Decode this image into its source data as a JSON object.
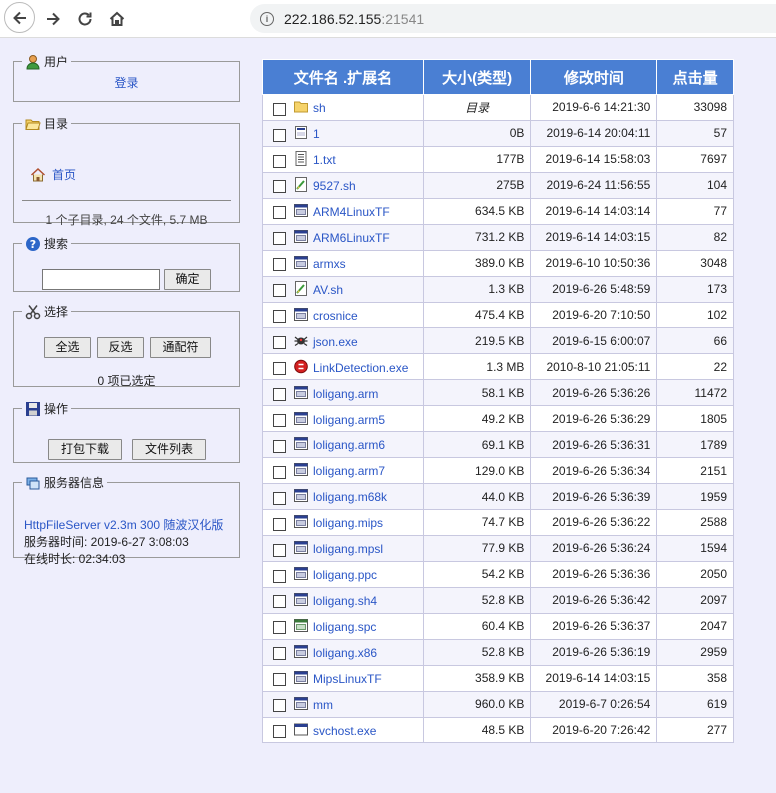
{
  "browser": {
    "url_host": "222.186.52.155",
    "url_port": ":21541"
  },
  "user_panel": {
    "legend": "用户",
    "login_link": "登录"
  },
  "dir_panel": {
    "legend": "目录",
    "home_link": "首页",
    "summary": "1 个子目录, 24 个文件, 5.7 MB"
  },
  "search_panel": {
    "legend": "搜索",
    "input_value": "",
    "submit_label": "确定"
  },
  "select_panel": {
    "legend": "选择",
    "select_all": "全选",
    "invert": "反选",
    "wildcard": "通配符",
    "selected_count": "0 项已选定"
  },
  "actions_panel": {
    "legend": "操作",
    "download_zip": "打包下载",
    "file_list": "文件列表"
  },
  "server_panel": {
    "legend": "服务器信息",
    "server_link": "HttpFileServer v2.3m 300 随波汉化版",
    "server_time": "服务器时间: 2019-6-27 3:08:03",
    "uptime": "在线时长: 02:34:03"
  },
  "table": {
    "headers": {
      "name": "文件名 .扩展名",
      "size": "大小(类型)",
      "modified": "修改时间",
      "hits": "点击量"
    },
    "rows": [
      {
        "icon": "folder-icon",
        "name": "sh",
        "size": "目录",
        "modified": "2019-6-6 14:21:30",
        "hits": "33098"
      },
      {
        "icon": "file-icon",
        "name": "1",
        "size": "0B",
        "modified": "2019-6-14 20:04:11",
        "hits": "57"
      },
      {
        "icon": "text-file-icon",
        "name": "1.txt",
        "size": "177B",
        "modified": "2019-6-14 15:58:03",
        "hits": "7697"
      },
      {
        "icon": "script-icon",
        "name": "9527.sh",
        "size": "275B",
        "modified": "2019-6-24 11:56:55",
        "hits": "104"
      },
      {
        "icon": "binary-icon",
        "name": "ARM4LinuxTF",
        "size": "634.5 KB",
        "modified": "2019-6-14 14:03:14",
        "hits": "77"
      },
      {
        "icon": "binary-icon",
        "name": "ARM6LinuxTF",
        "size": "731.2 KB",
        "modified": "2019-6-14 14:03:15",
        "hits": "82"
      },
      {
        "icon": "binary-icon",
        "name": "armxs",
        "size": "389.0 KB",
        "modified": "2019-6-10 10:50:36",
        "hits": "3048"
      },
      {
        "icon": "script-icon",
        "name": "AV.sh",
        "size": "1.3 KB",
        "modified": "2019-6-26 5:48:59",
        "hits": "173"
      },
      {
        "icon": "binary-icon",
        "name": "crosnice",
        "size": "475.4 KB",
        "modified": "2019-6-20 7:10:50",
        "hits": "102"
      },
      {
        "icon": "bug-icon",
        "name": "json.exe",
        "size": "219.5 KB",
        "modified": "2019-6-15 6:00:07",
        "hits": "66"
      },
      {
        "icon": "red-exe-icon",
        "name": "LinkDetection.exe",
        "size": "1.3 MB",
        "modified": "2010-8-10 21:05:11",
        "hits": "22"
      },
      {
        "icon": "binary-icon",
        "name": "loligang.arm",
        "size": "58.1 KB",
        "modified": "2019-6-26 5:36:26",
        "hits": "11472"
      },
      {
        "icon": "binary-icon",
        "name": "loligang.arm5",
        "size": "49.2 KB",
        "modified": "2019-6-26 5:36:29",
        "hits": "1805"
      },
      {
        "icon": "binary-icon",
        "name": "loligang.arm6",
        "size": "69.1 KB",
        "modified": "2019-6-26 5:36:31",
        "hits": "1789"
      },
      {
        "icon": "binary-icon",
        "name": "loligang.arm7",
        "size": "129.0 KB",
        "modified": "2019-6-26 5:36:34",
        "hits": "2151"
      },
      {
        "icon": "binary-icon",
        "name": "loligang.m68k",
        "size": "44.0 KB",
        "modified": "2019-6-26 5:36:39",
        "hits": "1959"
      },
      {
        "icon": "binary-icon",
        "name": "loligang.mips",
        "size": "74.7 KB",
        "modified": "2019-6-26 5:36:22",
        "hits": "2588"
      },
      {
        "icon": "binary-icon",
        "name": "loligang.mpsl",
        "size": "77.9 KB",
        "modified": "2019-6-26 5:36:24",
        "hits": "1594"
      },
      {
        "icon": "binary-icon",
        "name": "loligang.ppc",
        "size": "54.2 KB",
        "modified": "2019-6-26 5:36:36",
        "hits": "2050"
      },
      {
        "icon": "binary-icon",
        "name": "loligang.sh4",
        "size": "52.8 KB",
        "modified": "2019-6-26 5:36:42",
        "hits": "2097"
      },
      {
        "icon": "green-binary-icon",
        "name": "loligang.spc",
        "size": "60.4 KB",
        "modified": "2019-6-26 5:36:37",
        "hits": "2047"
      },
      {
        "icon": "binary-icon",
        "name": "loligang.x86",
        "size": "52.8 KB",
        "modified": "2019-6-26 5:36:19",
        "hits": "2959"
      },
      {
        "icon": "binary-icon",
        "name": "MipsLinuxTF",
        "size": "358.9 KB",
        "modified": "2019-6-14 14:03:15",
        "hits": "358"
      },
      {
        "icon": "binary-icon",
        "name": "mm",
        "size": "960.0 KB",
        "modified": "2019-6-7 0:26:54",
        "hits": "619"
      },
      {
        "icon": "window-icon",
        "name": "svchost.exe",
        "size": "48.5 KB",
        "modified": "2019-6-20 7:26:42",
        "hits": "277"
      }
    ]
  }
}
